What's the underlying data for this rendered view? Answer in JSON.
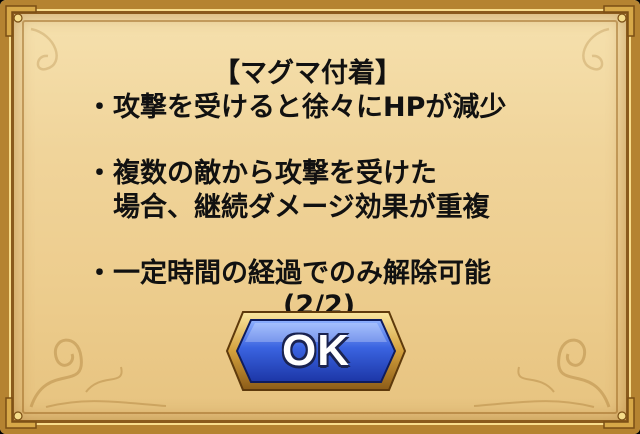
{
  "dialog": {
    "title": "【マグマ付着】",
    "bullet_1": "・攻撃を受けると徐々にHPが減少",
    "bullet_2_line_1": "・複数の敵から攻撃を受けた",
    "bullet_2_line_2": "場合、継続ダメージ効果が重複",
    "bullet_3": "・一定時間の経過でのみ解除可能",
    "page_indicator": "(2/2)",
    "ok_label": "OK"
  },
  "colors": {
    "parchment": "#f0d49a",
    "frame_gold": "#b58331",
    "text": "#111111",
    "button_blue": "#2a4fc8",
    "button_outline": "#1a2350"
  }
}
